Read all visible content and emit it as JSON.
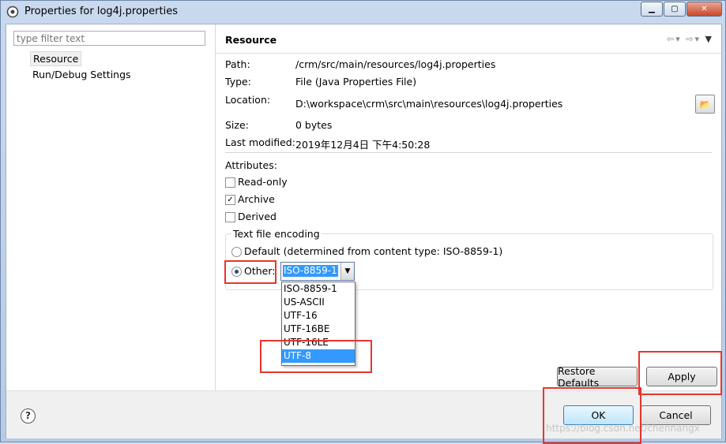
{
  "window": {
    "title": "Properties for log4j.properties"
  },
  "sidebar": {
    "filter_placeholder": "type filter text",
    "items": [
      {
        "label": "Resource"
      },
      {
        "label": "Run/Debug Settings"
      }
    ]
  },
  "resource": {
    "header": "Resource",
    "path_label": "Path:",
    "path_value": "/crm/src/main/resources/log4j.properties",
    "type_label": "Type:",
    "type_value": "File  (Java Properties File)",
    "location_label": "Location:",
    "location_value": "D:\\workspace\\crm\\src\\main\\resources\\log4j.properties",
    "size_label": "Size:",
    "size_value": "0  bytes",
    "modified_label": "Last modified:",
    "modified_value": "2019年12月4日 下午4:50:28",
    "attributes_label": "Attributes:",
    "attributes": [
      {
        "label": "Read-only",
        "checked": false
      },
      {
        "label": "Archive",
        "checked": true
      },
      {
        "label": "Derived",
        "checked": false
      }
    ],
    "encoding": {
      "group_label": "Text file encoding",
      "default_label": "Default (determined from content type: ISO-8859-1)",
      "other_label": "Other:",
      "selected_value": "ISO-8859-1",
      "options": [
        "ISO-8859-1",
        "US-ASCII",
        "UTF-16",
        "UTF-16BE",
        "UTF-16LE",
        "UTF-8"
      ],
      "highlighted_option": "UTF-8"
    },
    "restore_defaults_label": "Restore Defaults",
    "apply_label": "Apply"
  },
  "footer": {
    "ok_label": "OK",
    "cancel_label": "Cancel",
    "help_symbol": "?"
  },
  "watermark": "https://blog.csdn.net/chenhangx",
  "colors": {
    "highlight": "#e8342e",
    "selection": "#3399ff"
  }
}
